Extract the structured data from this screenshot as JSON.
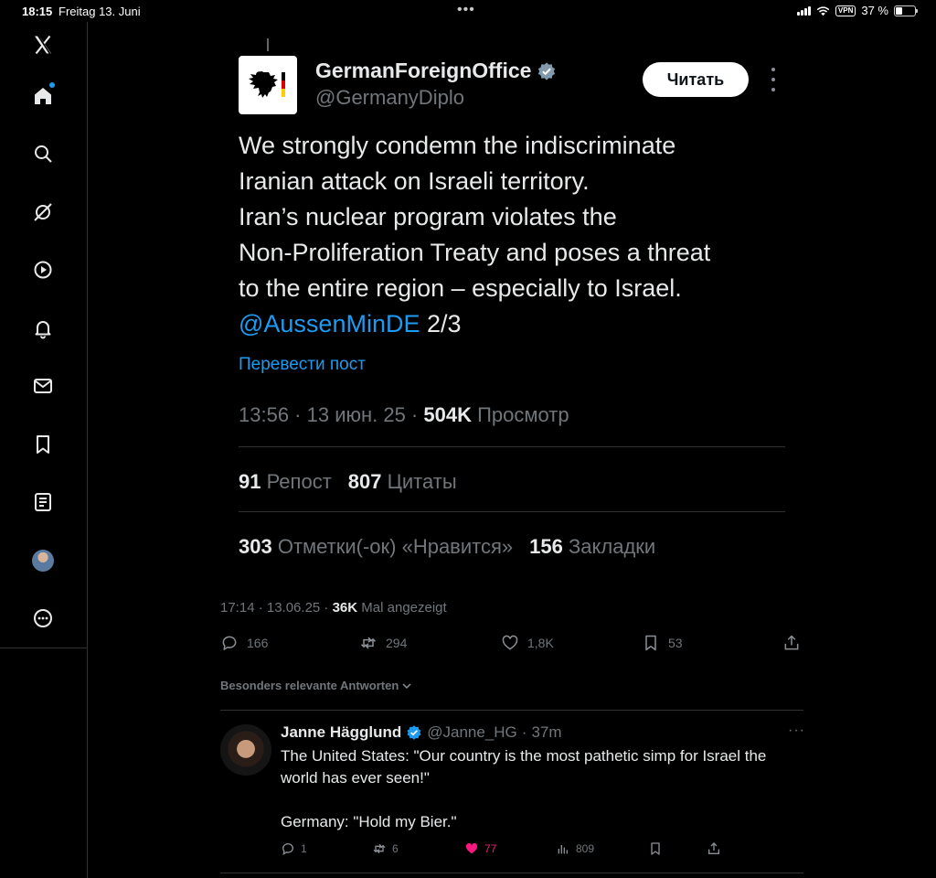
{
  "status_bar": {
    "time": "18:15",
    "date": "Freitag 13. Juni",
    "dots": "•••",
    "vpn": "VPN",
    "battery": "37 %",
    "battery_level": 0.37
  },
  "sidebar": {
    "items": [
      {
        "icon": "x-logo-icon"
      },
      {
        "icon": "home-icon",
        "has_notification": true
      },
      {
        "icon": "search-icon"
      },
      {
        "icon": "grok-icon"
      },
      {
        "icon": "video-icon"
      },
      {
        "icon": "bell-icon"
      },
      {
        "icon": "mail-icon"
      },
      {
        "icon": "bookmark-icon"
      },
      {
        "icon": "lists-icon"
      },
      {
        "icon": "profile-avatar"
      },
      {
        "icon": "more-icon"
      }
    ]
  },
  "embedded_post": {
    "author_name": "GermanForeignOffice",
    "handle": "@GermanyDiplo",
    "follow_label": "Читать",
    "text_lines": [
      "We strongly condemn the indiscriminate",
      "Iranian attack on Israeli territory.",
      "Iran’s nuclear program violates the",
      "Non-Proliferation Treaty and poses a threat",
      "to the entire region – especially to Israel."
    ],
    "mention": "@AussenMinDE",
    "suffix": " 2/3",
    "translate_label": "Перевести пост",
    "time_date": "13:56 · 13 июн. 25 · ",
    "views": "504K",
    "views_label": " Просмотр",
    "reposts": "91",
    "reposts_label": " Репост",
    "quotes": "807",
    "quotes_label": " Цитаты",
    "likes": "303",
    "likes_label": " Отметки(-ок) «Нравится»",
    "bookmarks": "156",
    "bookmarks_label": " Закладки"
  },
  "main_post": {
    "time_date": "17:14 · 13.06.25 · ",
    "views": "36K",
    "views_label": " Mal angezeigt",
    "replies": "166",
    "reposts": "294",
    "likes": "1,8K",
    "bookmarks": "53"
  },
  "replies_section": {
    "sort_label": "Besonders relevante Antworten"
  },
  "reply": {
    "name": "Janne Hägglund",
    "handle": "@Janne_HG",
    "time": "37m",
    "more": "···",
    "text_p1": "The United States: \"Our country is the most pathetic simp for Israel the world has ever seen!\"",
    "text_p2": "Germany: \"Hold my Bier.\"",
    "replies": "1",
    "reposts": "6",
    "likes": "77",
    "views": "809",
    "colors": {
      "like_active": "#f91880",
      "accent": "#1d9bf0"
    }
  }
}
